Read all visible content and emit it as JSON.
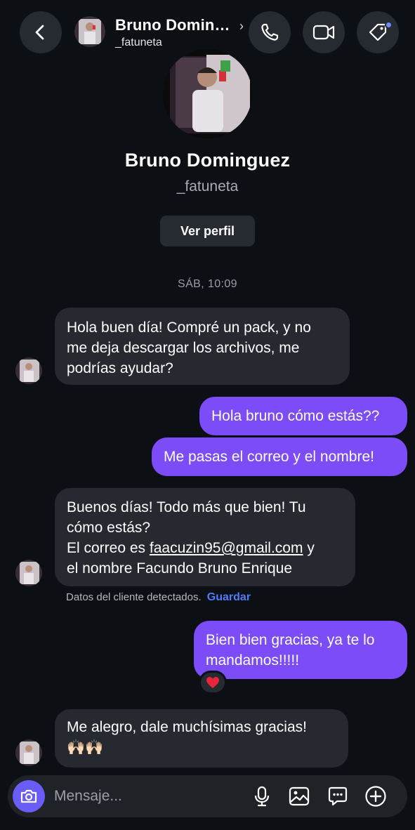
{
  "header": {
    "name": "Bruno Domin…",
    "username": "_fatuneta",
    "chevron": "›"
  },
  "profile": {
    "name": "Bruno Dominguez",
    "username": "_fatuneta",
    "view_profile_label": "Ver perfil"
  },
  "timestamp": "SÁB, 10:09",
  "messages": [
    {
      "direction": "in",
      "lines": [
        "Hola buen día! Compré un pack, y no",
        "me deja descargar los archivos, me",
        "podrías ayudar?"
      ]
    },
    {
      "direction": "out",
      "lines": [
        "Hola bruno cómo estás??"
      ]
    },
    {
      "direction": "out",
      "lines": [
        "Me pasas el correo y el nombre!"
      ]
    },
    {
      "direction": "in",
      "lines": [
        "Buenos días! Todo más que bien! Tu",
        "cómo estás?",
        "El correo es",
        "faacuzin95@gmail.com",
        " y",
        "el nombre Facundo Bruno Enrique"
      ]
    },
    {
      "direction": "out",
      "lines": [
        "Bien bien gracias, ya te lo",
        "mandamos!!!!!"
      ],
      "reaction": "❤️"
    },
    {
      "direction": "in",
      "lines": [
        "Me alegro, dale muchísimas gracias!",
        "🙌🏻🙌🏻"
      ]
    }
  ],
  "detected_notice": {
    "text": "Datos del cliente detectados.",
    "action": "Guardar"
  },
  "composer": {
    "placeholder": "Mensaje..."
  },
  "colors": {
    "background": "#0c0f14",
    "incoming_bubble": "#26292f",
    "outgoing_bubble": "#7b4cf7",
    "accent_link": "#4d7cff",
    "camera_button": "#6a5cf6"
  },
  "icons": [
    "back-arrow-icon",
    "phone-icon",
    "video-camera-icon",
    "tag-icon",
    "camera-icon",
    "microphone-icon",
    "image-icon",
    "sticker-chat-icon",
    "plus-circle-icon"
  ]
}
